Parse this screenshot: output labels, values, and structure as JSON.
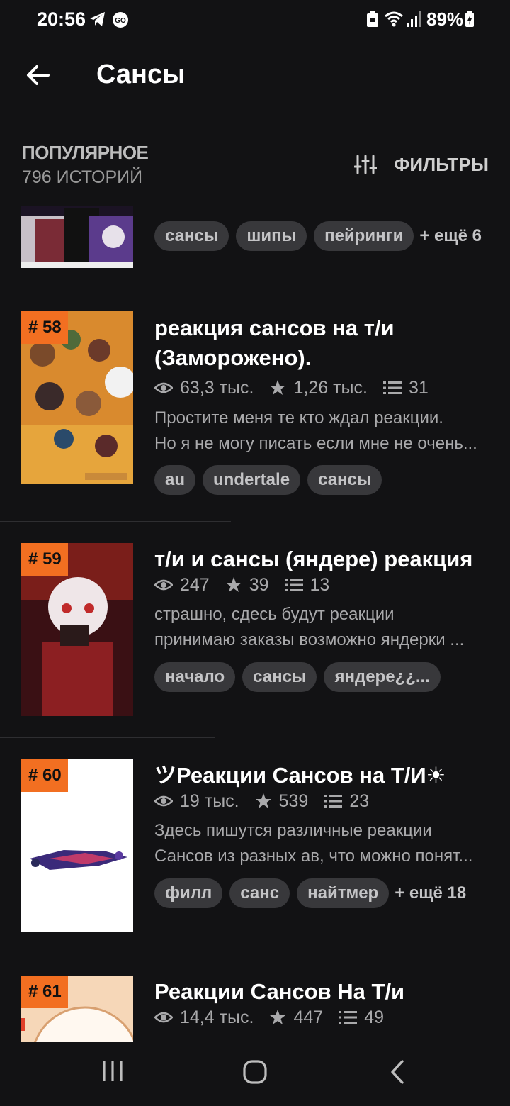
{
  "status_bar": {
    "time": "20:56",
    "battery": "89%"
  },
  "header": {
    "title": "Сансы"
  },
  "sort": {
    "label": "ПОПУЛЯРНОЕ",
    "count": "796 ИСТОРИЙ",
    "filters_label": "ФИЛЬТРЫ"
  },
  "stories": [
    {
      "tags": [
        "сансы",
        "шипы",
        "пейринги"
      ],
      "more": "+ ещё 6"
    },
    {
      "rank": "# 58",
      "title_lines": [
        "реакция сансов на т/и",
        "(Заморожено)."
      ],
      "views": "63,3 тыс.",
      "stars": "1,26 тыс.",
      "parts": "31",
      "desc_lines": [
        "Простите меня те кто ждал реакции.",
        "Но я не могу писать если мне не очень..."
      ],
      "tags": [
        "au",
        "undertale",
        "сансы"
      ]
    },
    {
      "rank": "# 59",
      "title_lines": [
        "т/и  и сансы (яндере) реакция"
      ],
      "views": "247",
      "stars": "39",
      "parts": "13",
      "desc_lines": [
        "страшно, сдесь будут реакции",
        "принимаю заказы возможно яндерки ..."
      ],
      "tags": [
        "начало",
        "сансы",
        "яндере¿¿..."
      ]
    },
    {
      "rank": "# 60",
      "title_lines": [
        "ツРеакции Сансов на  Т/И☀"
      ],
      "views": "19 тыс.",
      "stars": "539",
      "parts": "23",
      "desc_lines": [
        "Здесь пишутся различные реакции",
        "Сансов из разных ав, что можно понят..."
      ],
      "tags": [
        "филл",
        "санс",
        "найтмер"
      ],
      "more": "+ ещё 18"
    },
    {
      "rank": "# 61",
      "title_lines": [
        "Реакции Сансов На Т/и"
      ],
      "views": "14,4 тыс.",
      "stars": "447",
      "parts": "49"
    }
  ],
  "icons": {
    "back": "arrow-left-icon",
    "filters": "sliders-icon",
    "views": "eye-icon",
    "stars": "star-icon",
    "parts": "list-icon",
    "nav": [
      "recent-apps-icon",
      "home-icon",
      "back-nav-icon"
    ]
  },
  "colors": {
    "background": "#121214",
    "rank_badge": "#f26f21",
    "tag_bg": "#38383b",
    "text_muted": "#a9a9ab"
  }
}
